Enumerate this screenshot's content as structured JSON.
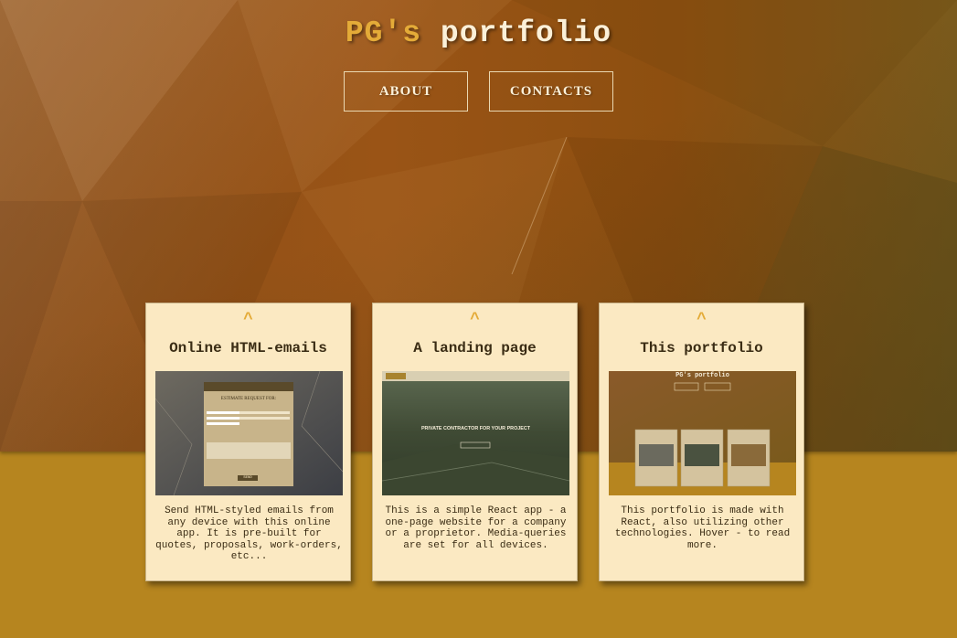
{
  "header": {
    "title_prefix": "PG's",
    "title_suffix": "portfolio"
  },
  "nav": {
    "about_label": "ABOUT",
    "contacts_label": "CONTACTS"
  },
  "cards": [
    {
      "chevron": "^",
      "title": "Online HTML-emails",
      "description": "Send HTML-styled emails from any device with this online app. It is pre-built for quotes, proposals, work-orders, etc...",
      "thumb_heading": "ESTIMATE REQUEST FOR:",
      "thumb_button": "SEND"
    },
    {
      "chevron": "^",
      "title": "A landing page",
      "description": "This is a simple React app - a one-page website for a company or a proprietor. Media-queries are set for all devices.",
      "thumb_heading": "PRIVATE CONTRACTOR FOR YOUR PROJECT"
    },
    {
      "chevron": "^",
      "title": "This portfolio",
      "description": "This portfolio is made with React, also utilizing other technologies. Hover - to read more.",
      "thumb_heading": "PG's portfolio"
    }
  ],
  "colors": {
    "accent": "#e4ab38",
    "card_bg": "#fbe9c2",
    "lower_bg": "#b6851f",
    "hero_bg": "#9a5416"
  }
}
